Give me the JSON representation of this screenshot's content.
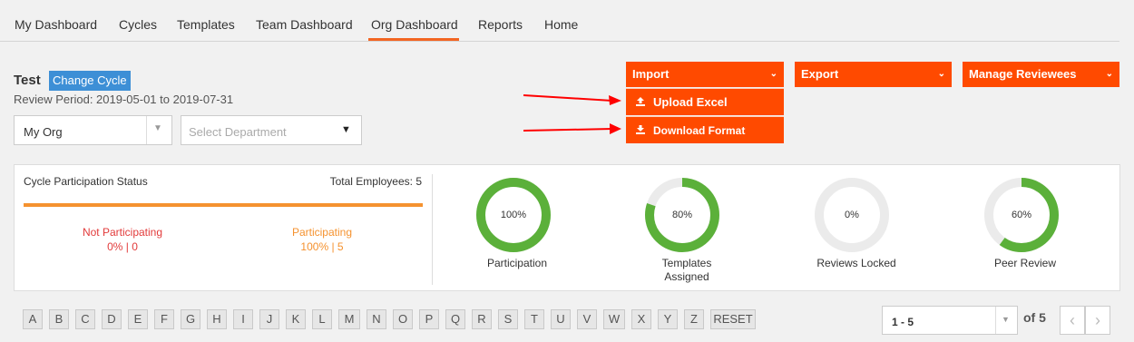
{
  "nav": {
    "items": [
      {
        "label": "My Dashboard"
      },
      {
        "label": "Cycles"
      },
      {
        "label": "Templates"
      },
      {
        "label": "Team Dashboard"
      },
      {
        "label": "Org Dashboard"
      },
      {
        "label": "Reports"
      },
      {
        "label": "Home"
      }
    ],
    "active": "Org Dashboard"
  },
  "cycle": {
    "title": "Test",
    "change_label": "Change Cycle",
    "review_period": "Review Period: 2019-05-01 to 2019-07-31"
  },
  "filters": {
    "org_value": "My Org",
    "dept_placeholder": "Select Department"
  },
  "actions": {
    "import_label": "Import",
    "export_label": "Export",
    "manage_label": "Manage Reviewees",
    "import_menu": {
      "upload_label": "Upload Excel",
      "download_label": "Download Format"
    }
  },
  "participation": {
    "title": "Cycle Participation Status",
    "total_employees": "Total Employees: 5",
    "not_participating_label": "Not Participating",
    "not_participating_value": "0% | 0",
    "participating_label": "Participating",
    "participating_value": "100% | 5"
  },
  "metrics": [
    {
      "label": "Participation",
      "value_text": "100%",
      "value": 100
    },
    {
      "label": "Templates Assigned",
      "value_text": "80%",
      "value": 80
    },
    {
      "label": "Reviews Locked",
      "value_text": "0%",
      "value": 0
    },
    {
      "label": "Peer Review",
      "value_text": "60%",
      "value": 60
    }
  ],
  "colors": {
    "accent_orange": "#ff4a00",
    "donut_fill": "#5bb03a",
    "donut_track": "#ebebeb",
    "cycle_button": "#3d8fd6",
    "not_participating": "#e23b3b",
    "participating": "#f5922f",
    "annotation_arrow": "#ff0000"
  },
  "alphabet": [
    "A",
    "B",
    "C",
    "D",
    "E",
    "F",
    "G",
    "H",
    "I",
    "J",
    "K",
    "L",
    "M",
    "N",
    "O",
    "P",
    "Q",
    "R",
    "S",
    "T",
    "U",
    "V",
    "W",
    "X",
    "Y",
    "Z",
    "RESET"
  ],
  "pagination": {
    "range": "1 - 5",
    "of_label": "of 5",
    "prev": "‹",
    "next": "›"
  }
}
